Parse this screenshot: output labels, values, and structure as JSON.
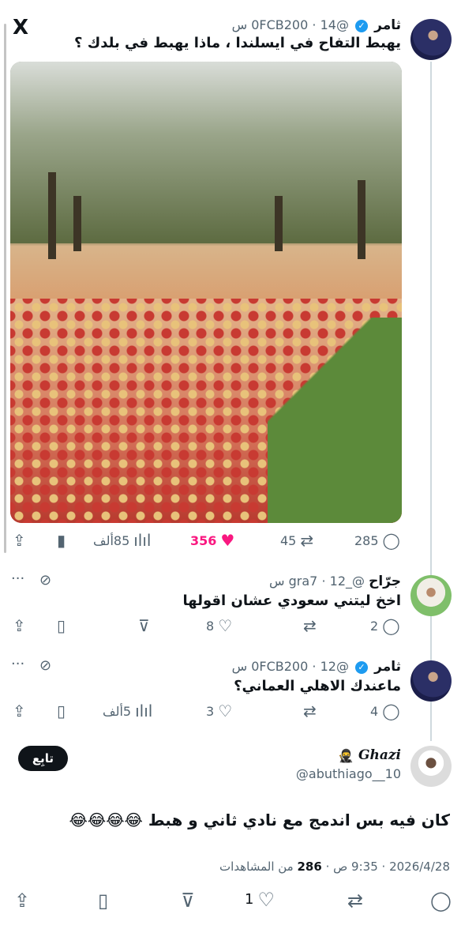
{
  "logo": "X",
  "tweet1": {
    "name": "ثامر",
    "handle": "@0FCB200",
    "time": "14 س",
    "text": "يهبط التفاح في ايسلندا ، ماذا يهبط في بلدك ؟",
    "image_desc": "apple-orchard-photo",
    "stats": {
      "replies": "285",
      "retweets": "45",
      "likes": "356",
      "views": "85ألف"
    }
  },
  "reply1": {
    "name": "جرّاح",
    "handle": "@_gra7",
    "time": "12 س",
    "text": "اخخ ليتني سعودي عشان اقولها",
    "stats": {
      "replies": "2",
      "likes": "8"
    }
  },
  "reply2": {
    "name": "ثامر",
    "handle": "@0FCB200",
    "time": "12 س",
    "text": "ماعندك الاهلي العماني؟",
    "stats": {
      "replies": "4",
      "likes": "3",
      "views": "5ألف"
    }
  },
  "main": {
    "name": "Ghazi",
    "handle": "@abuthiago__10",
    "follow_label": "تابِع",
    "text": "كان فيه بس اندمج مع نادي ثاني و هبط 😂😂😂😂",
    "date": "2026/4/28",
    "time": "9:35 ص",
    "views_count": "286",
    "views_label": "من المشاهدات",
    "like_count": "1"
  },
  "colors": {
    "accent": "#1d9bf0",
    "like": "#f91880",
    "muted": "#536471"
  }
}
